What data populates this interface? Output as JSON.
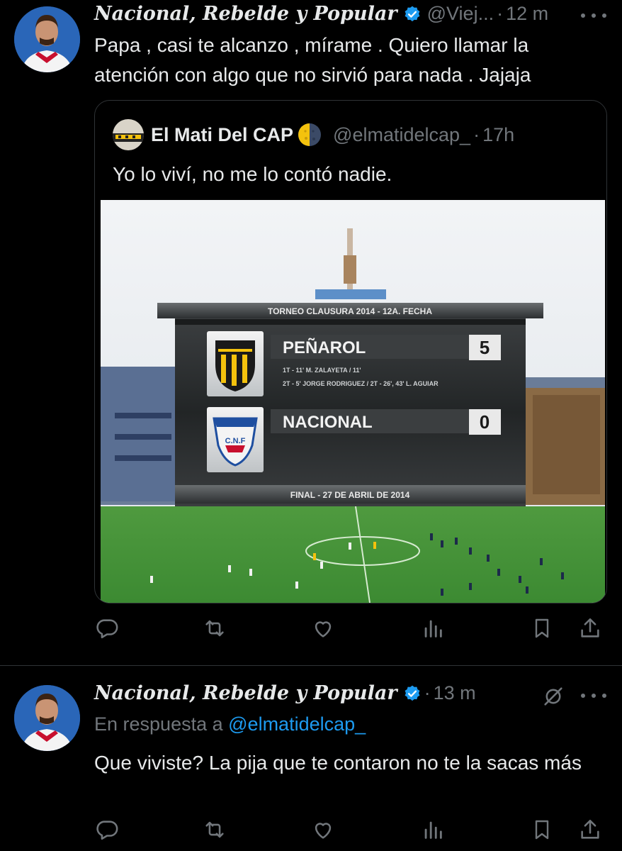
{
  "tweet1": {
    "display_name": "Nacional, Rebelde y Popular",
    "handle": "@Viej...",
    "separator": "·",
    "time": "12 m",
    "text": "Papa , casi te alcanzo , mírame . Quiero llamar la atención con algo que no sirvió para nada . Jajaja",
    "quote": {
      "display_name": "El Mati Del CAP",
      "handle": "@elmatidelcap_",
      "separator": "·",
      "time": "17h",
      "text": "Yo lo viví, no me lo contó nadie.",
      "scoreboard": {
        "competition": "TORNEO CLAUSURA 2014 - 12A. FECHA",
        "home_team": "PEÑAROL",
        "home_score": "5",
        "home_scorers_line1": "1T - 11' M. ZALAYETA / 11'",
        "home_scorers_line2": "2T - 5' JORGE RODRIGUEZ / 2T - 26', 43' L. AGUIAR",
        "away_team": "NACIONAL",
        "away_score": "0",
        "away_crest_text": "C.N.F",
        "footer": "FINAL - 27 DE ABRIL DE 2014",
        "home_color": "#f4c20d",
        "away_color": "#1f4fa0"
      }
    }
  },
  "tweet2": {
    "display_name": "Nacional, Rebelde y Popular",
    "separator": "·",
    "time": "13 m",
    "reply_prefix": "En respuesta a",
    "reply_mention": "@elmatidelcap_",
    "text": "Que viviste? La pija que te contaron no te la sacas más"
  },
  "actions": [
    "reply-icon",
    "retweet-icon",
    "like-icon",
    "views-icon",
    "bookmark-icon",
    "share-icon"
  ],
  "colors": {
    "background": "#000000",
    "text": "#e7e9ea",
    "muted": "#71767b",
    "accent": "#1d9bf0",
    "divider": "#2f3336"
  }
}
